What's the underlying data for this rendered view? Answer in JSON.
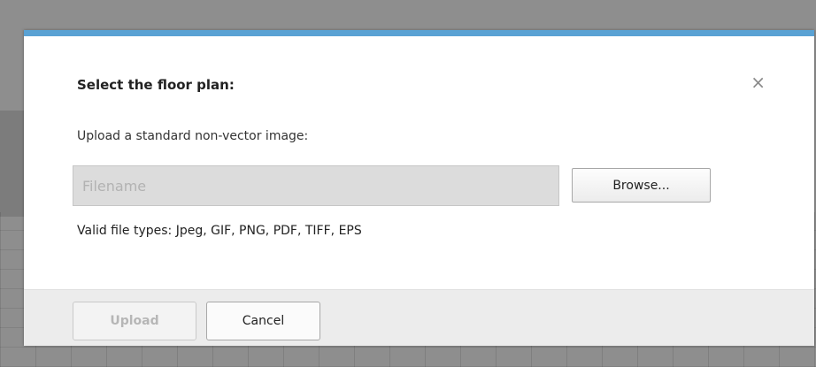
{
  "dialog": {
    "title": "Select the floor plan:",
    "close_symbol": "×",
    "upload_prompt": "Upload a standard non-vector image:",
    "file_input": {
      "value": "",
      "placeholder": "Filename"
    },
    "browse_label": "Browse...",
    "valid_types": "Valid file types: Jpeg, GIF, PNG, PDF, TIFF, EPS",
    "footer": {
      "upload_label": "Upload",
      "cancel_label": "Cancel"
    }
  },
  "colors": {
    "accent_bar": "#5aa2d4",
    "backdrop": "#8e8e8e"
  },
  "icons": {
    "close": "close-icon"
  }
}
